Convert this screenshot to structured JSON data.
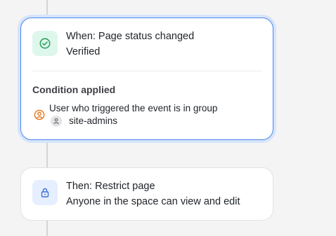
{
  "trigger": {
    "title": "When: Page status changed",
    "value": "Verified",
    "icon": "check-circle-icon",
    "icon_color": "#1f9d55",
    "accent": "#4a86e8"
  },
  "condition": {
    "heading": "Condition applied",
    "text": "User who triggered the event is in group",
    "icon": "user-circle-icon",
    "icon_color": "#e8741a",
    "group_icon": "user-icon",
    "group": "site-admins"
  },
  "action": {
    "title": "Then: Restrict page",
    "description": "Anyone in the space can view and edit",
    "icon": "lock-icon",
    "icon_color": "#3d6fd6"
  }
}
